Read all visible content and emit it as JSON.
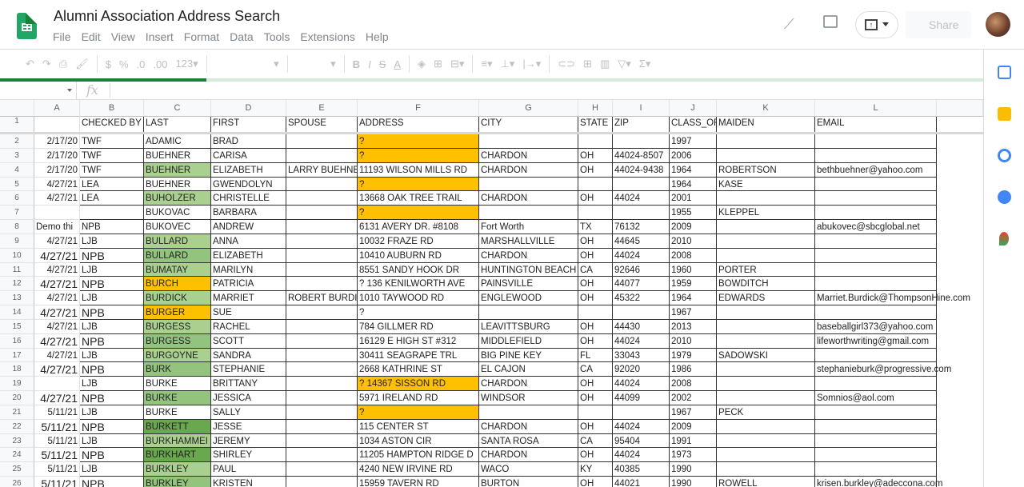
{
  "app": {
    "title": "Alumni Association Address Search",
    "menu": [
      "File",
      "Edit",
      "View",
      "Insert",
      "Format",
      "Data",
      "Tools",
      "Extensions",
      "Help"
    ],
    "share_label": "Share",
    "icons": [
      "sheets-logo-icon",
      "activity-trend-icon",
      "comment-icon",
      "present-icon",
      "avatar"
    ]
  },
  "toolbar": {
    "items": [
      "undo-icon",
      "redo-icon",
      "print-icon",
      "paint-format-icon",
      "$",
      "%",
      ".0",
      ".00",
      "123▾",
      "bold-icon",
      "italic-icon",
      "strikethrough-icon",
      "text-color-icon",
      "fill-color-icon",
      "borders-icon",
      "merge-icon",
      "align-icon",
      "valign-icon",
      "wrap-icon",
      "link-icon",
      "comment-add-icon",
      "chart-icon",
      "filter-icon",
      "sum-icon"
    ],
    "currency": "$",
    "percent": "%",
    "dec_less": ".0",
    "dec_more": ".00",
    "format": "123",
    "bold": "B",
    "italic": "I",
    "strike": "S",
    "textcolor": "A",
    "sum": "Σ"
  },
  "load_progress": 0.21,
  "formula_bar": {
    "fx": "fx",
    "name_box": "",
    "value": ""
  },
  "colors": {
    "orange": "#ffc000",
    "green_light": "#a9d08e",
    "green_mid": "#93c47d",
    "green_dark": "#6aa84f",
    "brand": "#188038"
  },
  "columns": [
    "A",
    "B",
    "C",
    "D",
    "E",
    "F",
    "G",
    "H",
    "I",
    "J",
    "K",
    "L"
  ],
  "header_row": [
    "",
    "CHECKED BY",
    "LAST",
    "FIRST",
    "SPOUSE",
    "ADDRESS",
    "CITY",
    "STATE",
    "ZIP",
    "CLASS_OF",
    "MAIDEN",
    "EMAIL"
  ],
  "rows": [
    {
      "n": 2,
      "c": [
        "2/17/20",
        "TWF",
        "ADAMIC",
        "BRAD",
        "",
        "?",
        "",
        "",
        "",
        "1997",
        "",
        ""
      ],
      "fill": {
        "F": "orange"
      }
    },
    {
      "n": 3,
      "c": [
        "2/17/20",
        "TWF",
        "BUEHNER",
        "CARISA",
        "",
        "?",
        "CHARDON",
        "OH",
        "44024-8507",
        "2006",
        "",
        ""
      ],
      "fill": {
        "F": "orange"
      }
    },
    {
      "n": 4,
      "c": [
        "2/17/20",
        "TWF",
        "BUEHNER",
        "ELIZABETH",
        "LARRY BUEHNE",
        "11193 WILSON MILLS RD",
        "CHARDON",
        "OH",
        "44024-9438",
        "1964",
        "ROBERTSON",
        "bethbuehner@yahoo.com"
      ],
      "fill": {
        "C": "green_light"
      }
    },
    {
      "n": 5,
      "c": [
        "4/27/21",
        "LEA",
        "BUEHNER",
        "GWENDOLYN",
        "",
        "?",
        "",
        "",
        "",
        "1964",
        "KASE",
        ""
      ],
      "fill": {
        "F": "orange"
      }
    },
    {
      "n": 6,
      "c": [
        "4/27/21",
        "LEA",
        "BUHOLZER",
        "CHRISTELLE",
        "",
        "13668 OAK TREE TRAIL",
        "CHARDON",
        "OH",
        "44024",
        "2001",
        "",
        ""
      ],
      "fill": {
        "C": "green_light"
      }
    },
    {
      "n": 7,
      "c": [
        "",
        "",
        "BUKOVAC",
        "BARBARA",
        "",
        "?",
        "",
        "",
        "",
        "1955",
        "KLEPPEL",
        ""
      ],
      "fill": {
        "F": "orange"
      }
    },
    {
      "n": 8,
      "c": [
        "Demo thi",
        "NPB",
        "BUKOVEC",
        "ANDREW",
        "",
        "6131 AVERY DR. #8108",
        "Fort Worth",
        "TX",
        "76132",
        "2009",
        "",
        "abukovec@sbcglobal.net"
      ],
      "fill": {}
    },
    {
      "n": 9,
      "c": [
        "4/27/21",
        "LJB",
        "BULLARD",
        "ANNA",
        "",
        "10032 FRAZE RD",
        "MARSHALLVILLE",
        "OH",
        "44645",
        "2010",
        "",
        ""
      ],
      "fill": {
        "C": "green_light"
      }
    },
    {
      "n": 10,
      "c": [
        "4/27/21",
        "NPB",
        "BULLARD",
        "ELIZABETH",
        "",
        "10410 AUBURN RD",
        "CHARDON",
        "OH",
        "44024",
        "2008",
        "",
        ""
      ],
      "fill": {
        "C": "green_mid"
      },
      "big": true
    },
    {
      "n": 11,
      "c": [
        "4/27/21",
        "LJB",
        "BUMATAY",
        "MARILYN",
        "",
        "8551 SANDY HOOK DR",
        "HUNTINGTON BEACH",
        "CA",
        "92646",
        "1960",
        "PORTER",
        ""
      ],
      "fill": {
        "C": "green_light"
      }
    },
    {
      "n": 12,
      "c": [
        "4/27/21",
        "NPB",
        "BURCH",
        "PATRICIA",
        "",
        "? 136 KENILWORTH AVE",
        "PAINSVILLE",
        "OH",
        "44077",
        "1959",
        "BOWDITCH",
        ""
      ],
      "fill": {
        "C": "orange"
      },
      "big": true
    },
    {
      "n": 13,
      "c": [
        "4/27/21",
        "LJB",
        "BURDICK",
        "MARRIET",
        "ROBERT BURDI",
        "1010 TAYWOOD RD",
        "ENGLEWOOD",
        "OH",
        "45322",
        "1964",
        "EDWARDS",
        "Marriet.Burdick@ThompsonHine.com"
      ],
      "fill": {
        "C": "green_light"
      }
    },
    {
      "n": 14,
      "c": [
        "4/27/21",
        "NPB",
        "BURGER",
        "SUE",
        "",
        "?",
        "",
        "",
        "",
        "1967",
        "",
        ""
      ],
      "fill": {
        "C": "orange"
      },
      "big": true
    },
    {
      "n": 15,
      "c": [
        "4/27/21",
        "LJB",
        "BURGESS",
        "RACHEL",
        "",
        "784 GILLMER RD",
        "LEAVITTSBURG",
        "OH",
        "44430",
        "2013",
        "",
        "baseballgirl373@yahoo.com"
      ],
      "fill": {
        "C": "green_light"
      }
    },
    {
      "n": 16,
      "c": [
        "4/27/21",
        "NPB",
        "BURGESS",
        "SCOTT",
        "",
        "16129 E HIGH ST #312",
        "MIDDLEFIELD",
        "OH",
        "44024",
        "2010",
        "",
        "lifeworthwriting@gmail.com"
      ],
      "fill": {
        "C": "green_mid"
      },
      "big": true
    },
    {
      "n": 17,
      "c": [
        "4/27/21",
        "LJB",
        "BURGOYNE",
        "SANDRA",
        "",
        "30411 SEAGRAPE TRL",
        "BIG PINE KEY",
        "FL",
        "33043",
        "1979",
        "SADOWSKI",
        ""
      ],
      "fill": {
        "C": "green_light"
      }
    },
    {
      "n": 18,
      "c": [
        "4/27/21",
        "NPB",
        "BURK",
        "STEPHANIE",
        "",
        "2668 KATHRINE ST",
        "EL CAJON",
        "CA",
        "92020",
        "1986",
        "",
        "stephanieburk@progressive.com"
      ],
      "fill": {
        "C": "green_mid"
      },
      "big": true
    },
    {
      "n": 19,
      "c": [
        "",
        "LJB",
        "BURKE",
        "BRITTANY",
        "",
        "? 14367 SISSON RD",
        "CHARDON",
        "OH",
        "44024",
        "2008",
        "",
        ""
      ],
      "fill": {
        "F": "orange"
      }
    },
    {
      "n": 20,
      "c": [
        "4/27/21",
        "NPB",
        "BURKE",
        "JESSICA",
        "",
        "5971 IRELAND RD",
        "WINDSOR",
        "OH",
        "44099",
        "2002",
        "",
        "Somnios@aol.com"
      ],
      "fill": {
        "C": "green_mid"
      },
      "big": true
    },
    {
      "n": 21,
      "c": [
        "5/11/21",
        "LJB",
        "BURKE",
        "SALLY",
        "",
        "?",
        "",
        "",
        "",
        "1967",
        "PECK",
        ""
      ],
      "fill": {
        "F": "orange"
      }
    },
    {
      "n": 22,
      "c": [
        "5/11/21",
        "NPB",
        "BURKETT",
        "JESSE",
        "",
        "115 CENTER ST",
        "CHARDON",
        "OH",
        "44024",
        "2009",
        "",
        ""
      ],
      "fill": {
        "C": "green_dark"
      },
      "big": true
    },
    {
      "n": 23,
      "c": [
        "5/11/21",
        "LJB",
        "BURKHAMMEI",
        "JEREMY",
        "",
        "1034 ASTON CIR",
        "SANTA ROSA",
        "CA",
        "95404",
        "1991",
        "",
        ""
      ],
      "fill": {
        "C": "green_light"
      }
    },
    {
      "n": 24,
      "c": [
        "5/11/21",
        "NPB",
        "BURKHART",
        "SHIRLEY",
        "",
        "11205 HAMPTON RIDGE D",
        "CHARDON",
        "OH",
        "44024",
        "1973",
        "",
        ""
      ],
      "fill": {
        "C": "green_dark"
      },
      "big": true
    },
    {
      "n": 25,
      "c": [
        "5/11/21",
        "LJB",
        "BURKLEY",
        "PAUL",
        "",
        "4240 NEW IRVINE RD",
        "WACO",
        "KY",
        "40385",
        "1990",
        "",
        ""
      ],
      "fill": {
        "C": "green_light"
      }
    },
    {
      "n": 26,
      "c": [
        "5/11/21",
        "NPB",
        "BURKLEY",
        "KRISTEN",
        "",
        "15959 TAVERN RD",
        "BURTON",
        "OH",
        "44021",
        "1990",
        "ROWELL",
        "krisen.burkley@adeccona.com"
      ],
      "fill": {
        "C": "green_mid"
      },
      "big": true
    }
  ]
}
